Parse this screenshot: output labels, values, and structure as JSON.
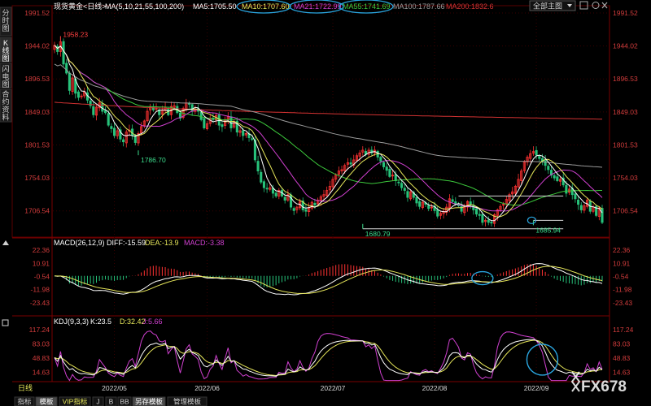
{
  "header": {
    "title": "现货黄金<日线>",
    "ma_list": "MA(5,10,21,55,100,200)",
    "ma5": "MA5:1705.50",
    "ma10": "MA10:1707.60",
    "ma21": "MA21:1722.99",
    "ma55": "MA55:1741.69",
    "ma100": "MA100:1787.66",
    "ma200": "MA200:1832.6",
    "layout_button": "全部主图",
    "down_icon": "chevron-down-icon",
    "expand_icon": "expand-icon",
    "settings_icon": "gear-icon",
    "close_icon": "close-icon"
  },
  "sidebar": {
    "items": [
      "分时图",
      "K线图",
      "闪电图",
      "合约资料"
    ]
  },
  "watermark": "FX678",
  "bottom_tabs": [
    "日线",
    "指标",
    "模板",
    "VIP指标",
    "J",
    "B",
    "BB",
    "另存模板",
    "管理模板"
  ],
  "colors": {
    "up": "#ff3232",
    "down": "#27c27a",
    "ma5": "#ffffff",
    "ma10": "#e6e65a",
    "ma21": "#d040d0",
    "ma55": "#3cc83c",
    "ma100": "#9a9a9a",
    "ma200": "#d23232",
    "highlight_circle": "#2aa6e0",
    "axis_text": "#d23c3c"
  },
  "chart_data": [
    {
      "type": "candlestick",
      "title": "现货黄金<日线>",
      "y_axis_ticks": [
        1991.52,
        1944.02,
        1896.53,
        1849.03,
        1801.53,
        1754.03,
        1706.54
      ],
      "ylim": [
        1670,
        1991.52
      ],
      "x_ticks": [
        {
          "label": "2022/05",
          "at_bar": 20
        },
        {
          "label": "2022/06",
          "at_bar": 51
        },
        {
          "label": "2022/07",
          "at_bar": 93
        },
        {
          "label": "2022/08",
          "at_bar": 127
        },
        {
          "label": "2022/09",
          "at_bar": 161
        }
      ],
      "annotations": [
        {
          "text": "1958.23",
          "value": 1958.23,
          "at_bar": 2
        },
        {
          "text": "1786.70",
          "value": 1786.7,
          "at_bar": 28
        },
        {
          "text": "1680.79",
          "value": 1680.79,
          "at_bar": 103
        },
        {
          "text": "1685.94",
          "value": 1685.94,
          "at_bar": 160
        }
      ],
      "horizontal_levels": [
        {
          "value": 1680.79,
          "from_bar": 103,
          "to_bar": 170
        },
        {
          "value": 1693,
          "from_bar": 160,
          "to_bar": 170
        },
        {
          "value": 1728,
          "from_bar": 135,
          "to_bar": 170
        }
      ],
      "closes": [
        1945,
        1936,
        1950,
        1918,
        1905,
        1880,
        1898,
        1876,
        1870,
        1872,
        1878,
        1866,
        1858,
        1845,
        1856,
        1862,
        1850,
        1848,
        1830,
        1825,
        1815,
        1822,
        1810,
        1806,
        1820,
        1823,
        1815,
        1805,
        1818,
        1828,
        1836,
        1850,
        1856,
        1852,
        1854,
        1845,
        1852,
        1856,
        1845,
        1857,
        1858,
        1848,
        1840,
        1854,
        1862,
        1860,
        1850,
        1852,
        1850,
        1838,
        1826,
        1832,
        1840,
        1838,
        1844,
        1830,
        1828,
        1838,
        1842,
        1826,
        1834,
        1820,
        1822,
        1815,
        1818,
        1812,
        1810,
        1780,
        1764,
        1748,
        1740,
        1738,
        1740,
        1732,
        1728,
        1736,
        1728,
        1722,
        1730,
        1712,
        1707,
        1712,
        1720,
        1708,
        1706,
        1711,
        1719,
        1715,
        1722,
        1727,
        1730,
        1736,
        1742,
        1752,
        1758,
        1764,
        1766,
        1772,
        1776,
        1774,
        1780,
        1786,
        1790,
        1794,
        1788,
        1794,
        1790,
        1794,
        1784,
        1778,
        1770,
        1765,
        1756,
        1758,
        1750,
        1748,
        1740,
        1736,
        1726,
        1734,
        1726,
        1718,
        1713,
        1719,
        1716,
        1710,
        1712,
        1707,
        1699,
        1703,
        1706,
        1712,
        1724,
        1720,
        1716,
        1714,
        1706,
        1712,
        1720,
        1716,
        1708,
        1702,
        1700,
        1690,
        1693,
        1690,
        1689,
        1701,
        1708,
        1713,
        1716,
        1723,
        1730,
        1734,
        1742,
        1752,
        1764,
        1777,
        1784,
        1789,
        1792,
        1787,
        1782,
        1778,
        1772,
        1766,
        1758,
        1754,
        1750,
        1752,
        1744,
        1732,
        1738,
        1730,
        1724,
        1716,
        1708,
        1714,
        1722,
        1706,
        1712,
        1700,
        1711,
        1690
      ]
    },
    {
      "type": "bar+line",
      "title": "MACD(26,12,9)",
      "series": [
        {
          "name": "DIFF",
          "last": -15.59
        },
        {
          "name": "DEA",
          "last": -13.9
        },
        {
          "name": "MACD",
          "last": -3.38
        }
      ],
      "y_axis_ticks": [
        22.36,
        10.91,
        -0.54,
        -11.98,
        -23.43
      ]
    },
    {
      "type": "line",
      "title": "KDJ(9,3,3)",
      "series": [
        {
          "name": "K",
          "last": 23.5
        },
        {
          "name": "D",
          "last": 32.42
        },
        {
          "name": "J",
          "last": 5.66
        }
      ],
      "y_axis_ticks": [
        117.24,
        83.03,
        48.83,
        14.63
      ]
    }
  ]
}
